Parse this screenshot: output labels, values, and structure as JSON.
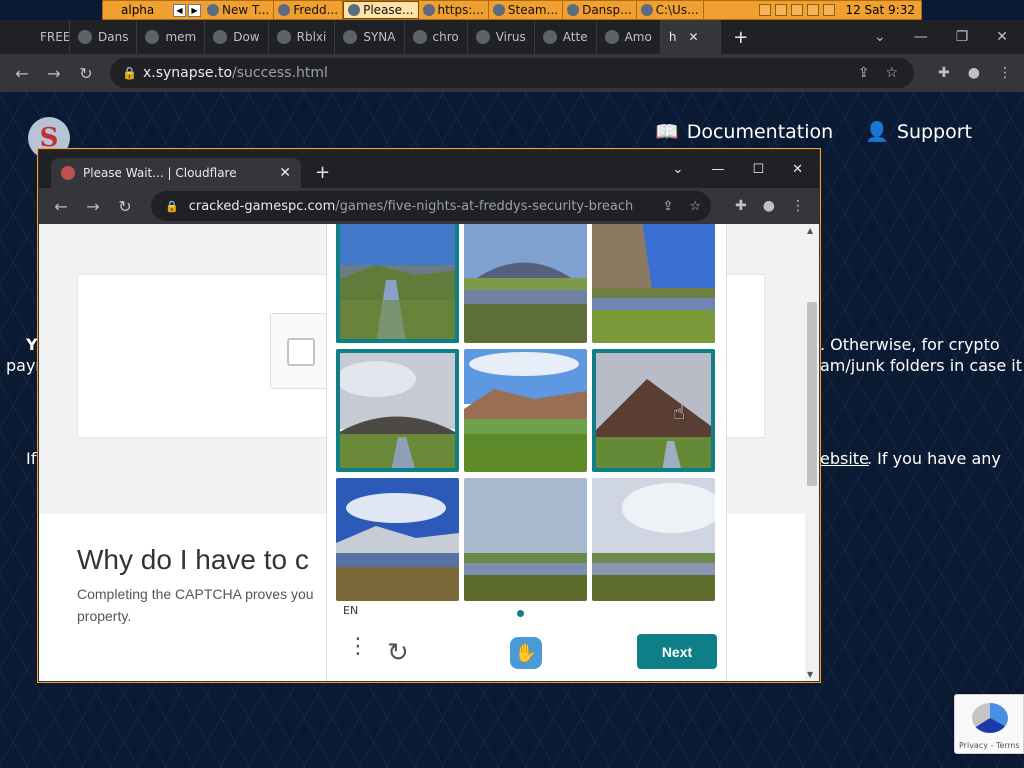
{
  "taskbar": {
    "app": "alpha",
    "tasks": [
      {
        "label": "New T..."
      },
      {
        "label": "Fredd..."
      },
      {
        "label": "Please...",
        "active": true
      },
      {
        "label": "https:..."
      },
      {
        "label": "Steam..."
      },
      {
        "label": "Dansp..."
      },
      {
        "label": "C:\\Us..."
      }
    ],
    "clock": "12 Sat 9:32"
  },
  "outer_browser": {
    "tabs": [
      "FREE",
      "Dans",
      "mem",
      "Dow",
      "Rblxi",
      "SYNA",
      "chro",
      "Virus",
      "Atte",
      "Amo",
      "h"
    ],
    "url_host": "x.synapse.to",
    "url_path": "/success.html"
  },
  "site": {
    "logo_letter": "S",
    "nav": [
      "Documentation",
      "Support"
    ],
    "text_fragments": [
      "Yo",
      "payr",
      ". Otherwise, for crypto",
      "am/junk folders in case it",
      "If",
      "ebsite",
      ". If you have any"
    ]
  },
  "inner_browser": {
    "tab_title": "Please Wait... | Cloudflare",
    "url_host": "cracked-gamespc.com",
    "url_path": "/games/five-nights-at-freddys-security-breach",
    "heading": "Why do I have to c",
    "subtext": "Completing the CAPTCHA proves you",
    "subtext2": "property."
  },
  "captcha": {
    "language": "EN",
    "next_label": "Next",
    "tiles": [
      {
        "selected": true,
        "scene": "river-mountain"
      },
      {
        "selected": false,
        "scene": "lake-hill"
      },
      {
        "selected": false,
        "scene": "cliff-lake"
      },
      {
        "selected": true,
        "scene": "cloudy-hill"
      },
      {
        "selected": false,
        "scene": "hill-stream"
      },
      {
        "selected": true,
        "scene": "brown-mountain"
      },
      {
        "selected": false,
        "scene": "snowy-mountain-lake"
      },
      {
        "selected": false,
        "scene": "misty-lake"
      },
      {
        "selected": false,
        "scene": "cloud-lake"
      }
    ]
  },
  "recaptcha": {
    "footer": "Privacy - Terms"
  },
  "colors": {
    "accent": "#0e7f86",
    "taskbar": "#f0a030",
    "site_bg": "#0b1a33"
  }
}
